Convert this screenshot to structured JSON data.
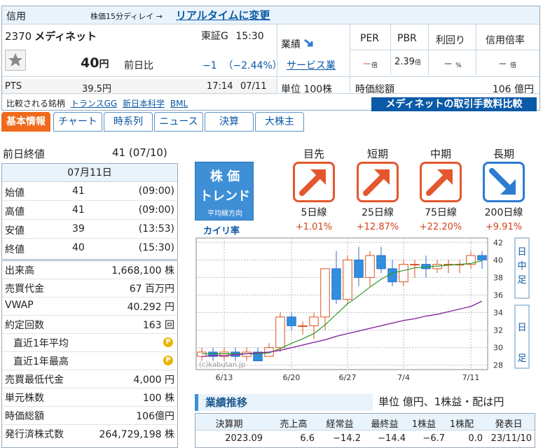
{
  "header": {
    "shinyo": "信用",
    "delay_note": "株価15分ディレイ →",
    "realtime_link": "リアルタイムに変更",
    "code": "2370",
    "name": "メディネット",
    "market": "東証G",
    "time": "15:30",
    "price": "40",
    "price_unit": "円",
    "prev_label": "前日比",
    "change": "−1",
    "change_pct": "（−2.44%）",
    "pts_label": "PTS",
    "pts_value": "39.5円",
    "pts_time": "17:14",
    "pts_date": "07/11",
    "gyoseki_label": "業績",
    "sector": "サービス業",
    "unit_label": "単位",
    "unit_value": "100株",
    "indicators": [
      {
        "label": "PER",
        "value": "－",
        "unit": "倍"
      },
      {
        "label": "PBR",
        "value": "2.39",
        "unit": "倍"
      },
      {
        "label": "利回り",
        "value": "－",
        "unit": "%"
      },
      {
        "label": "信用倍率",
        "value": "－",
        "unit": "倍"
      }
    ],
    "market_cap_label": "時価総額",
    "market_cap_value": "106 億円",
    "compare_label": "比較される銘柄",
    "compare_links": [
      "トランスGG",
      "新日本科学",
      "BML"
    ],
    "fee_button": "メディネットの取引手数料比較"
  },
  "tabs": [
    "基本情報",
    "チャート",
    "時系列",
    "ニュース",
    "決算",
    "大株主"
  ],
  "left": {
    "prev_close_label": "前日終値",
    "prev_close_value": "41 (07/10)",
    "date": "07月11日",
    "ohlc": [
      {
        "label": "始値",
        "value": "41",
        "time": "(09:00)"
      },
      {
        "label": "高値",
        "value": "41",
        "time": "(09:00)"
      },
      {
        "label": "安値",
        "value": "39",
        "time": "(13:53)"
      },
      {
        "label": "終値",
        "value": "40",
        "time": "(15:30)"
      }
    ],
    "stats": [
      {
        "label": "出来高",
        "value": "1,668,100 株"
      },
      {
        "label": "売買代金",
        "value": "67 百万円"
      },
      {
        "label": "VWAP",
        "value": "40.292 円"
      },
      {
        "label": "約定回数",
        "value": "163 回"
      },
      {
        "label": "直近1年平均",
        "value": ""
      },
      {
        "label": "直近1年最高",
        "value": ""
      },
      {
        "label": "売買最低代金",
        "value": "4,000 円"
      },
      {
        "label": "単元株数",
        "value": "100 株"
      },
      {
        "label": "時価総額",
        "value": "106億円"
      },
      {
        "label": "発行済株式数",
        "value": "264,729,198 株"
      }
    ],
    "coin_label": "P"
  },
  "trend": {
    "logo_line1": "株 価",
    "logo_line2": "トレンド",
    "logo_line3": "平均線方向",
    "kairi_label": "カイリ率",
    "terms": [
      {
        "term": "目先",
        "ma": "5日線",
        "kairi": "+1.01%",
        "direction": "up"
      },
      {
        "term": "短期",
        "ma": "25日線",
        "kairi": "+12.87%",
        "direction": "up"
      },
      {
        "term": "中期",
        "ma": "75日線",
        "kairi": "+22.20%",
        "direction": "up"
      },
      {
        "term": "長期",
        "ma": "200日線",
        "kairi": "+9.91%",
        "direction": "down"
      }
    ]
  },
  "chart_data": {
    "type": "candlestick",
    "x_ticks": [
      "6/13",
      "6/20",
      "6/27",
      "7/4",
      "7/11"
    ],
    "y_ticks": [
      28,
      30,
      32,
      34,
      36,
      38,
      40,
      42
    ],
    "ylim": [
      27.5,
      42.5
    ],
    "watermark": "(c)kabutan.jp",
    "side_labels": [
      "日中足",
      "日足"
    ],
    "candles": [
      {
        "o": 29.0,
        "h": 30.0,
        "l": 28.5,
        "c": 29.5
      },
      {
        "o": 29.5,
        "h": 30.0,
        "l": 28.5,
        "c": 29.0
      },
      {
        "o": 29.0,
        "h": 30.0,
        "l": 28.5,
        "c": 29.5
      },
      {
        "o": 29.5,
        "h": 30.0,
        "l": 28.5,
        "c": 29.0
      },
      {
        "o": 29.0,
        "h": 30.0,
        "l": 28.5,
        "c": 29.5
      },
      {
        "o": 29.5,
        "h": 30.0,
        "l": 28.5,
        "c": 28.5
      },
      {
        "o": 29.0,
        "h": 30.5,
        "l": 29.0,
        "c": 30.0
      },
      {
        "o": 30.0,
        "h": 34.0,
        "l": 29.5,
        "c": 33.5
      },
      {
        "o": 33.5,
        "h": 34.0,
        "l": 32.0,
        "c": 32.5
      },
      {
        "o": 32.5,
        "h": 33.0,
        "l": 31.5,
        "c": 32.5
      },
      {
        "o": 32.5,
        "h": 34.0,
        "l": 31.0,
        "c": 33.5
      },
      {
        "o": 33.5,
        "h": 39.0,
        "l": 32.0,
        "c": 39.0
      },
      {
        "o": 39.0,
        "h": 41.0,
        "l": 35.0,
        "c": 35.5
      },
      {
        "o": 35.5,
        "h": 40.5,
        "l": 35.0,
        "c": 40.0
      },
      {
        "o": 40.0,
        "h": 41.5,
        "l": 37.0,
        "c": 38.0
      },
      {
        "o": 38.0,
        "h": 41.0,
        "l": 37.0,
        "c": 40.5
      },
      {
        "o": 40.5,
        "h": 41.5,
        "l": 38.5,
        "c": 39.0
      },
      {
        "o": 39.0,
        "h": 40.0,
        "l": 37.0,
        "c": 37.5
      },
      {
        "o": 37.5,
        "h": 40.0,
        "l": 37.0,
        "c": 39.5
      },
      {
        "o": 39.5,
        "h": 40.0,
        "l": 38.0,
        "c": 39.5
      },
      {
        "o": 39.5,
        "h": 40.5,
        "l": 38.0,
        "c": 39.0
      },
      {
        "o": 39.0,
        "h": 40.0,
        "l": 38.5,
        "c": 39.5
      },
      {
        "o": 39.5,
        "h": 40.0,
        "l": 38.5,
        "c": 39.5
      },
      {
        "o": 39.5,
        "h": 40.0,
        "l": 38.5,
        "c": 39.5
      },
      {
        "o": 39.5,
        "h": 41.0,
        "l": 39.0,
        "c": 40.5
      },
      {
        "o": 40.5,
        "h": 41.0,
        "l": 39.0,
        "c": 40.0
      }
    ],
    "ma_short": [
      29.3,
      29.3,
      29.3,
      29.3,
      29.3,
      29.3,
      29.4,
      29.9,
      30.5,
      31.0,
      31.6,
      32.6,
      33.8,
      35.0,
      35.9,
      36.9,
      37.8,
      38.5,
      38.8,
      39.1,
      39.2,
      39.3,
      39.4,
      39.5,
      39.6,
      39.9
    ],
    "ma_long": [
      29.0,
      29.1,
      29.1,
      29.2,
      29.3,
      29.4,
      29.5,
      29.7,
      30.0,
      30.3,
      30.6,
      30.9,
      31.3,
      31.6,
      31.9,
      32.2,
      32.5,
      32.8,
      33.1,
      33.3,
      33.6,
      33.8,
      34.1,
      34.4,
      34.7,
      35.3
    ]
  },
  "earnings": {
    "title": "業績推移",
    "unit_note": "単位 億円、1株益・配は円",
    "columns": [
      "決算期",
      "売上高",
      "経常益",
      "最終益",
      "1株益",
      "1株配",
      "発表日"
    ],
    "rows": [
      [
        "2023.09",
        "6.6",
        "−14.2",
        "−14.4",
        "−6.7",
        "0.0",
        "23/11/10"
      ]
    ]
  }
}
